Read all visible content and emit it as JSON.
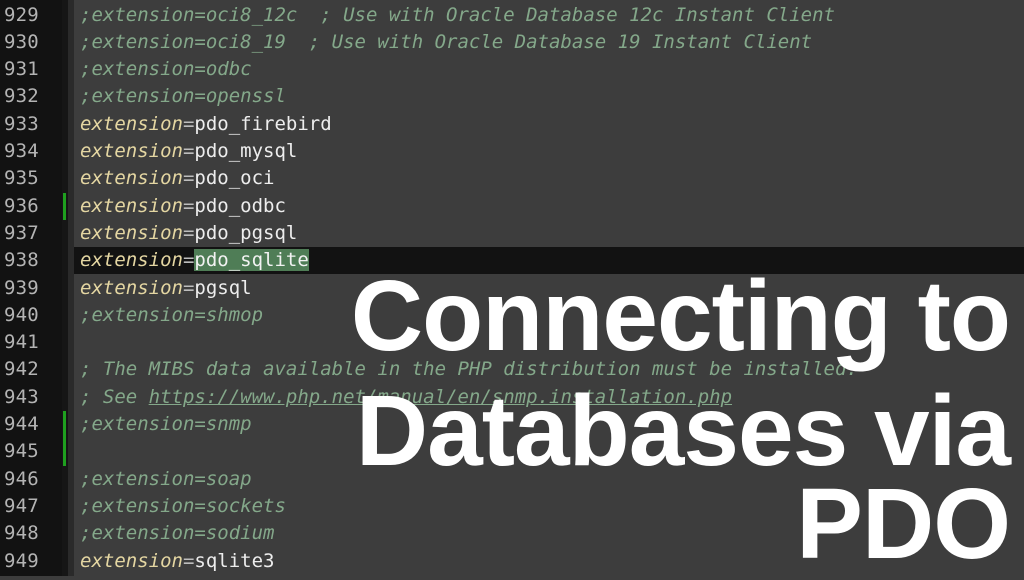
{
  "editor": {
    "current_line": 938,
    "changed_lines": [
      936,
      944,
      945
    ],
    "lines": [
      {
        "num": "929",
        "type": "comment",
        "text": ";extension=oci8_12c  ; Use with Oracle Database 12c Instant Client"
      },
      {
        "num": "930",
        "type": "comment",
        "text": ";extension=oci8_19  ; Use with Oracle Database 19 Instant Client"
      },
      {
        "num": "931",
        "type": "comment",
        "text": ";extension=odbc"
      },
      {
        "num": "932",
        "type": "comment",
        "text": ";extension=openssl"
      },
      {
        "num": "933",
        "type": "directive",
        "key": "extension",
        "eq": "=",
        "value": "pdo_firebird"
      },
      {
        "num": "934",
        "type": "directive",
        "key": "extension",
        "eq": "=",
        "value": "pdo_mysql"
      },
      {
        "num": "935",
        "type": "directive",
        "key": "extension",
        "eq": "=",
        "value": "pdo_oci"
      },
      {
        "num": "936",
        "type": "directive",
        "key": "extension",
        "eq": "=",
        "value": "pdo_odbc"
      },
      {
        "num": "937",
        "type": "directive",
        "key": "extension",
        "eq": "=",
        "value": "pdo_pgsql"
      },
      {
        "num": "938",
        "type": "directive",
        "key": "extension",
        "eq": "=",
        "value": "pdo_sqlite",
        "selected": true
      },
      {
        "num": "939",
        "type": "directive",
        "key": "extension",
        "eq": "=",
        "value": "pgsql"
      },
      {
        "num": "940",
        "type": "comment",
        "text": ";extension=shmop"
      },
      {
        "num": "941",
        "type": "blank",
        "text": ""
      },
      {
        "num": "942",
        "type": "comment",
        "text": "; The MIBS data available in the PHP distribution must be installed."
      },
      {
        "num": "943",
        "type": "comment-url",
        "prefix": "; See ",
        "url": "https://www.php.net/manual/en/snmp.installation.php"
      },
      {
        "num": "944",
        "type": "comment",
        "text": ";extension=snmp"
      },
      {
        "num": "945",
        "type": "blank",
        "text": ""
      },
      {
        "num": "946",
        "type": "comment",
        "text": ";extension=soap"
      },
      {
        "num": "947",
        "type": "comment",
        "text": ";extension=sockets"
      },
      {
        "num": "948",
        "type": "comment",
        "text": ";extension=sodium"
      },
      {
        "num": "949",
        "type": "directive",
        "key": "extension",
        "eq": "=",
        "value": "sqlite3"
      }
    ]
  },
  "overlay": {
    "line1": "Connecting to",
    "line2": "Databases via",
    "line3": "PDO"
  },
  "colors": {
    "comment": "#84a88a",
    "keyword": "#e4d6a2",
    "value": "#ededed",
    "selection": "#4f7d56",
    "change_marker": "#1fa01f",
    "background": "#3d3d3d",
    "gutter": "#121212"
  }
}
